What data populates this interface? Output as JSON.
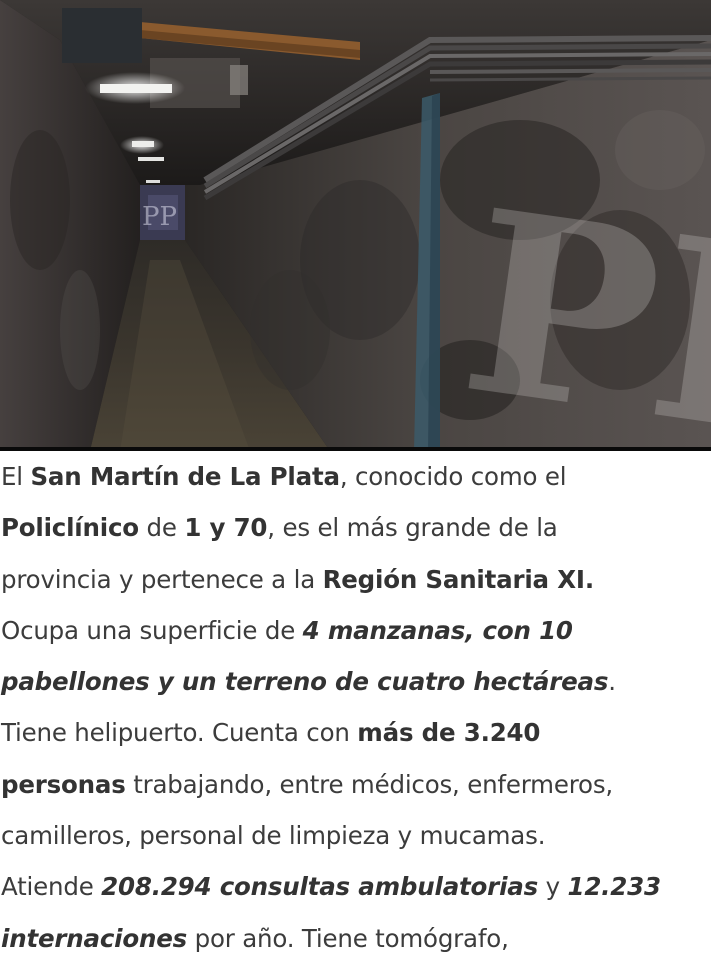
{
  "photo": {
    "watermark_text": "PP",
    "tunnel_watermark_text": "PP"
  },
  "paragraph": {
    "l1_a": "El ",
    "l1_b": "San Martín de La Plata",
    "l1_c": ", conocido como el",
    "l2_a": "Policlínico",
    "l2_b": " de ",
    "l2_c": "1 y 70",
    "l2_d": ", es el más grande de la",
    "l3_a": "provincia y pertenece a la ",
    "l3_b": "Región Sanitaria XI.",
    "l4_a": "Ocupa una superficie de ",
    "l4_b": "4 manzanas, con 10",
    "l5_a": "pabellones y un terreno de cuatro hectáreas",
    "l5_b": ".",
    "l6_a": "Tiene helipuerto. Cuenta con ",
    "l6_b": "más de 3.240",
    "l7_a": "personas",
    "l7_b": " trabajando, entre médicos, enfermeros,",
    "l8_a": "camilleros, personal de limpieza y mucamas.",
    "l9_a": "Atiende ",
    "l9_b": "208.294 consultas ambulatorias",
    "l9_c": " y ",
    "l9_d": "12.233",
    "l10_a": "internaciones",
    "l10_b": " por año. Tiene tomógrafo,"
  }
}
